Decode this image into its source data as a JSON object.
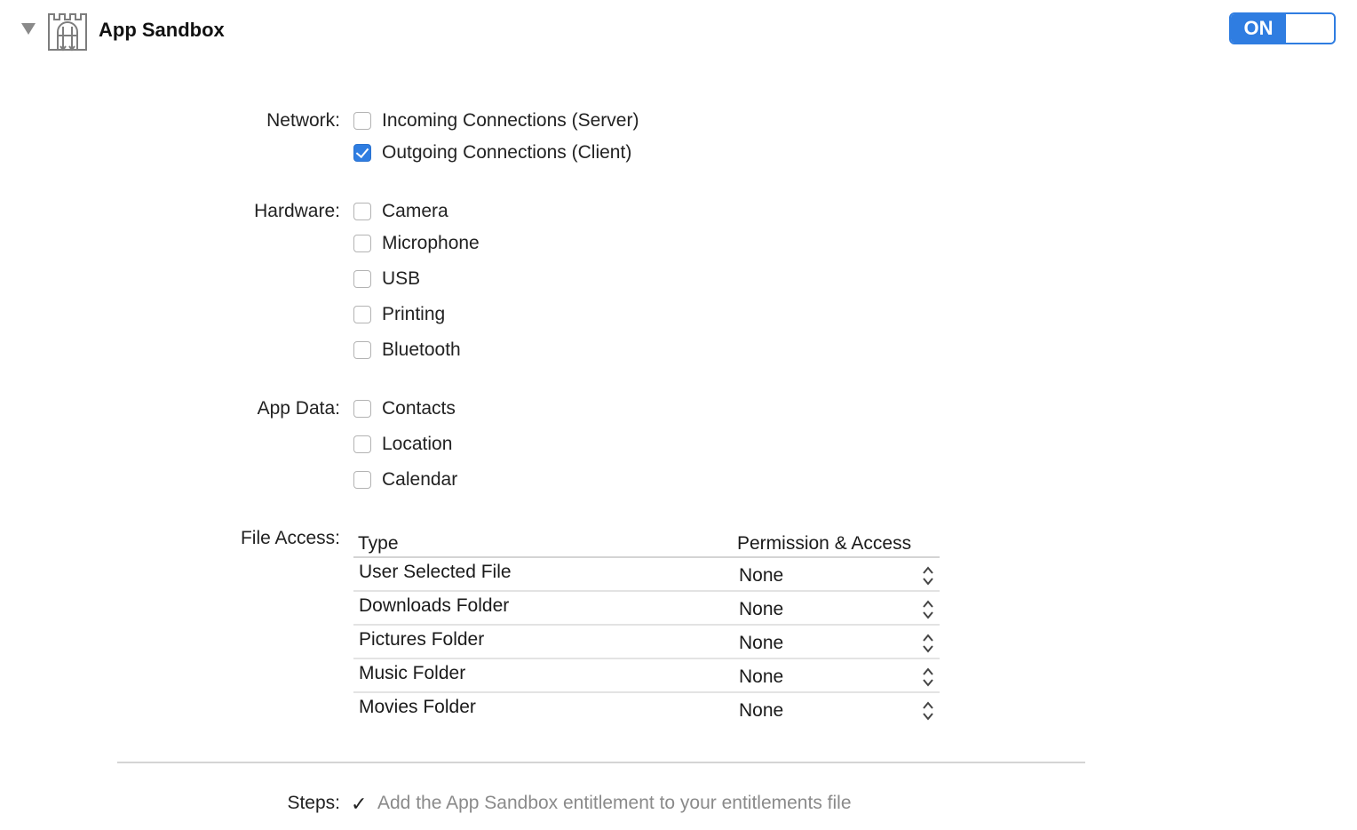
{
  "section": {
    "title": "App Sandbox",
    "toggle_label": "ON",
    "accent_color": "#2f7de1"
  },
  "network": {
    "label": "Network:",
    "items": [
      {
        "label": "Incoming Connections (Server)",
        "checked": false
      },
      {
        "label": "Outgoing Connections (Client)",
        "checked": true
      }
    ]
  },
  "hardware": {
    "label": "Hardware:",
    "items": [
      {
        "label": "Camera",
        "checked": false
      },
      {
        "label": "Microphone",
        "checked": false
      },
      {
        "label": "USB",
        "checked": false
      },
      {
        "label": "Printing",
        "checked": false
      },
      {
        "label": "Bluetooth",
        "checked": false
      }
    ]
  },
  "app_data": {
    "label": "App Data:",
    "items": [
      {
        "label": "Contacts",
        "checked": false
      },
      {
        "label": "Location",
        "checked": false
      },
      {
        "label": "Calendar",
        "checked": false
      }
    ]
  },
  "file_access": {
    "label": "File Access:",
    "columns": {
      "type": "Type",
      "permission": "Permission & Access"
    },
    "rows": [
      {
        "type": "User Selected File",
        "permission": "None"
      },
      {
        "type": "Downloads Folder",
        "permission": "None"
      },
      {
        "type": "Pictures Folder",
        "permission": "None"
      },
      {
        "type": "Music Folder",
        "permission": "None"
      },
      {
        "type": "Movies Folder",
        "permission": "None"
      }
    ]
  },
  "steps": {
    "label": "Steps:",
    "check_icon": "✓",
    "text": "Add the App Sandbox entitlement to your entitlements file"
  }
}
